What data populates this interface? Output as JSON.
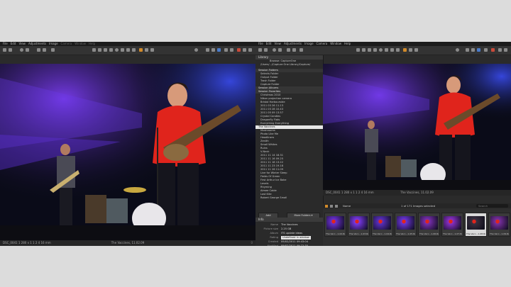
{
  "left_window": {
    "menu": [
      "File",
      "Edit",
      "View",
      "Adjustments",
      "Image"
    ],
    "menu_dim": [
      "Camera",
      "Window",
      "Help"
    ],
    "status": {
      "info": "DSC_0041 1 280 x 1 1 2 4 16 mm",
      "caption": "The Vaccines, 11.02.09",
      "right": "0"
    }
  },
  "right_window": {
    "menu": [
      "File",
      "Edit",
      "View",
      "Adjustments",
      "Image",
      "Camera",
      "Window",
      "Help"
    ],
    "library": {
      "header": "Library",
      "browse_label": "Browse",
      "browse_value": "CaptureOne",
      "path": "/Users/.../Capture One Library/Capture/",
      "items": [
        {
          "label": "Session Folders",
          "type": "sec"
        },
        {
          "label": "Selects Folder",
          "type": "sub"
        },
        {
          "label": "Output Folder",
          "type": "sub"
        },
        {
          "label": "Trash Folder",
          "type": "sub"
        },
        {
          "label": "Capture Folder",
          "type": "sub"
        },
        {
          "label": "Session Albums",
          "type": "sec"
        },
        {
          "label": "Session Favorites",
          "type": "sec"
        },
        {
          "label": "Christmas 2010",
          "type": "sub"
        },
        {
          "label": "Nikon projection camera",
          "type": "sub"
        },
        {
          "label": "Bristol Harbourside",
          "type": "sub"
        },
        {
          "label": "2011 03 26 11.13",
          "type": "sub"
        },
        {
          "label": "2011 03 28 10.43",
          "type": "sub"
        },
        {
          "label": "2011 05 09 13.57",
          "type": "sub"
        },
        {
          "label": "Crystal Candles",
          "type": "sub"
        },
        {
          "label": "Dragonfly Flats",
          "type": "sub"
        },
        {
          "label": "Everything Everything",
          "type": "sub"
        },
        {
          "label": "The Vaccines",
          "type": "sel"
        },
        {
          "label": "Mushrooms",
          "type": "sub"
        },
        {
          "label": "Photo Like Me",
          "type": "sub"
        },
        {
          "label": "Headliners",
          "type": "sub"
        },
        {
          "label": "Zenith",
          "type": "sub"
        },
        {
          "label": "Small Whites",
          "type": "sub"
        },
        {
          "label": "Ruins",
          "type": "sub"
        },
        {
          "label": "V-Neck",
          "type": "sub"
        },
        {
          "label": "2011 11 14 18.31",
          "type": "sub"
        },
        {
          "label": "2011 11 16 09.25",
          "type": "sub"
        },
        {
          "label": "2011 11 18 13.22",
          "type": "sub"
        },
        {
          "label": "2011 11 23 19.18",
          "type": "sub"
        },
        {
          "label": "2011 11 26 11.09",
          "type": "sub"
        },
        {
          "label": "Live for Winter Sleep",
          "type": "sub"
        },
        {
          "label": "Fields Of Green",
          "type": "sub"
        },
        {
          "label": "First Arthur Ice Bake",
          "type": "sub"
        },
        {
          "label": "Levels",
          "type": "sub"
        },
        {
          "label": "Rhyming",
          "type": "sub"
        },
        {
          "label": "Aimee Cable",
          "type": "sub"
        },
        {
          "label": "Lost Kite",
          "type": "sub"
        },
        {
          "label": "Robert George Small",
          "type": "sub"
        }
      ],
      "button_left": "Add",
      "button_right": "More Folders ▾"
    },
    "info": {
      "header": "Info",
      "rows": [
        {
          "k": "Name",
          "v": "The Vaccines",
          "box": false
        },
        {
          "k": "Picture size",
          "v": "2.25 GB",
          "box": false
        },
        {
          "k": "Album",
          "v": "ITS update ideas",
          "box": false
        },
        {
          "k": "Rating",
          "v": "Undefined in window",
          "box": true
        },
        {
          "k": "Created",
          "v": "09/02/2011 09:43:04",
          "box": false
        },
        {
          "k": "Modified",
          "v": "09/02/2011 09:22:35",
          "box": false
        },
        {
          "k": "Permissions",
          "v": "RW",
          "box": false
        }
      ]
    },
    "viewer_status": {
      "info": "DSC_0041 1 280 x 1 1 2 4 16 mm",
      "caption": "The Vaccines, 11.02.09"
    },
    "browser": {
      "sort_label": "Name",
      "count": "1 of 171 Images selected",
      "search_placeholder": "Search",
      "thumbs": [
        "The Vacc...1-02.RAF",
        "The Vacc...1-03.RAF",
        "The Vacc...1-04.RAF",
        "The Vacc...1-05.RAF",
        "The Vacc...1-06.RAF",
        "The Vacc...1-07.RAF",
        "The Vacc...1-08.RAF",
        "The Vacc...1-09.RAF"
      ],
      "selected_index": 6
    }
  },
  "colors": {
    "stage_purple": "#5a2fd0",
    "shirt_red": "#e0241c",
    "accent": "#d08a2a"
  }
}
